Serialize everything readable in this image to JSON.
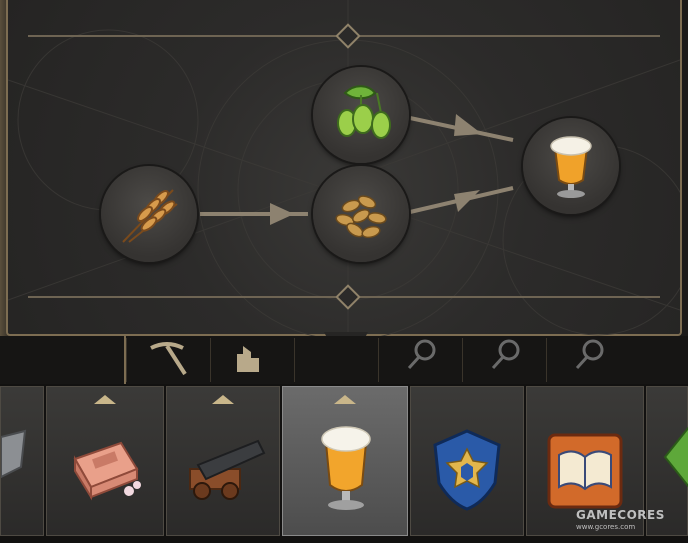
{
  "production_chain": {
    "inputs": [
      "wheat-icon"
    ],
    "intermediates": [
      "hops-icon",
      "malt-icon"
    ],
    "output": "beer-icon"
  },
  "toolbar": {
    "items": [
      {
        "icon": "partial-tool-icon",
        "selected": false,
        "has_caret": false
      },
      {
        "icon": "soap-icon",
        "selected": false,
        "has_caret": true
      },
      {
        "icon": "cannon-icon",
        "selected": false,
        "has_caret": true
      },
      {
        "icon": "beer-icon",
        "selected": true,
        "has_caret": true
      },
      {
        "icon": "police-badge-icon",
        "selected": false,
        "has_caret": false
      },
      {
        "icon": "book-icon",
        "selected": false,
        "has_caret": false
      },
      {
        "icon": "partial-green-icon",
        "selected": false,
        "has_caret": false
      }
    ]
  },
  "category_strip": [
    "pickaxe-icon",
    "building-icon",
    "partial-icon",
    "magnifier-icon",
    "magnifier-icon",
    "magnifier-icon"
  ],
  "watermark": {
    "brand": "GAMECORES",
    "url": "www.gcores.com"
  }
}
